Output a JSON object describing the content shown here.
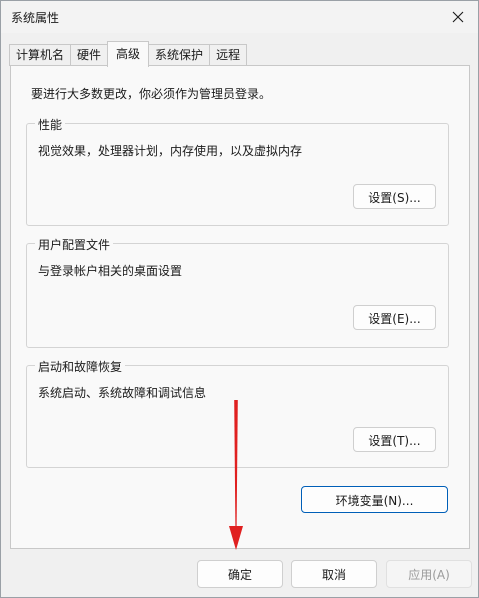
{
  "window": {
    "title": "系统属性",
    "close_icon": "close-icon"
  },
  "tabs": [
    {
      "label": "计算机名",
      "active": false
    },
    {
      "label": "硬件",
      "active": false
    },
    {
      "label": "高级",
      "active": true
    },
    {
      "label": "系统保护",
      "active": false
    },
    {
      "label": "远程",
      "active": false
    }
  ],
  "advanced": {
    "intro": "要进行大多数更改，你必须作为管理员登录。",
    "performance": {
      "title": "性能",
      "description": "视觉效果，处理器计划，内存使用，以及虚拟内存",
      "button": "设置(S)..."
    },
    "user_profiles": {
      "title": "用户配置文件",
      "description": "与登录帐户相关的桌面设置",
      "button": "设置(E)..."
    },
    "startup_recovery": {
      "title": "启动和故障恢复",
      "description": "系统启动、系统故障和调试信息",
      "button": "设置(T)..."
    },
    "env_button": "环境变量(N)..."
  },
  "footer": {
    "ok": "确定",
    "cancel": "取消",
    "apply": "应用(A)"
  },
  "annotation": {
    "arrow_color": "#e02020",
    "arrow_icon": "red-arrow-icon"
  }
}
